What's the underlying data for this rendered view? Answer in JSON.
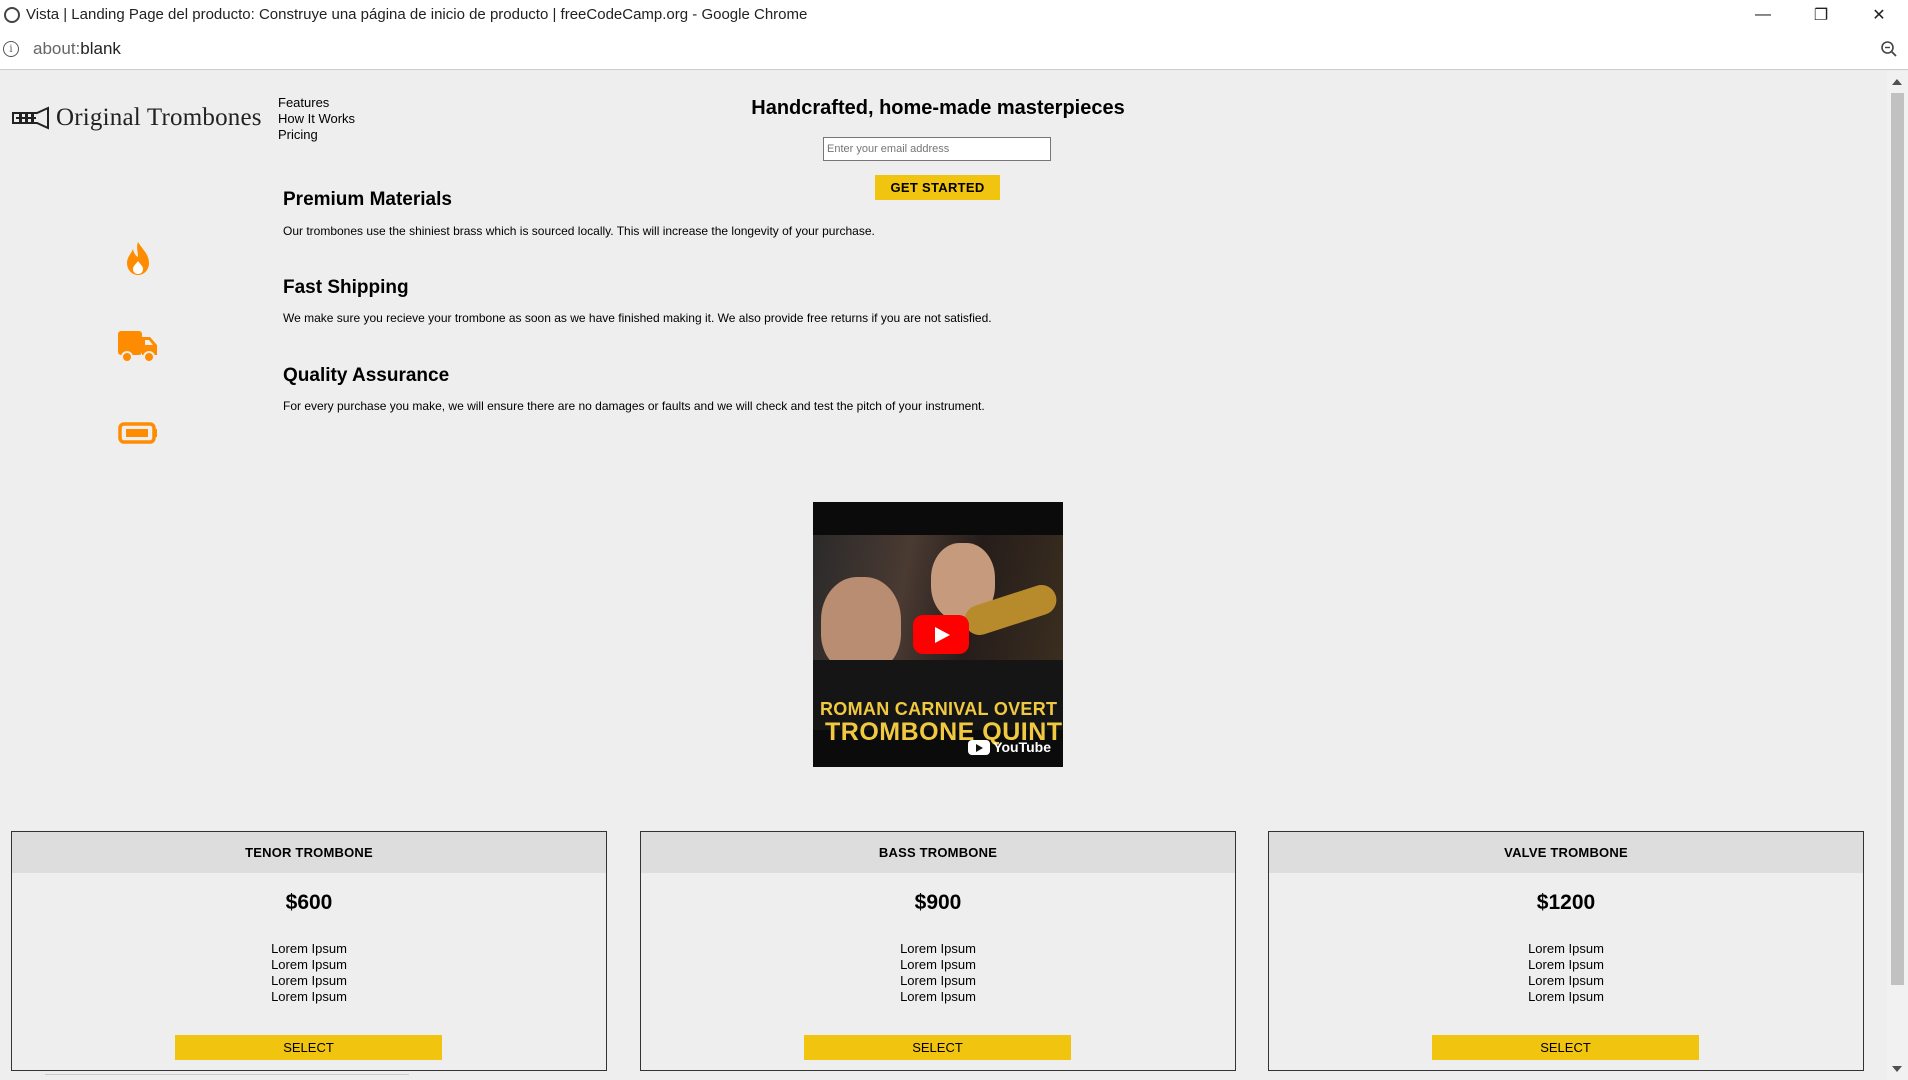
{
  "window": {
    "title": "Vista | Landing Page del producto: Construye una página de inicio de producto | freeCodeCamp.org - Google Chrome",
    "minimize": "—",
    "restore": "❐",
    "close": "✕"
  },
  "address": {
    "scheme": "about:",
    "path": "blank"
  },
  "header": {
    "logo_text": "Original Trombones",
    "nav": [
      "Features",
      "How It Works",
      "Pricing"
    ]
  },
  "hero": {
    "title": "Handcrafted, home-made masterpieces",
    "email_placeholder": "Enter your email address",
    "cta_label": "GET STARTED"
  },
  "features": [
    {
      "icon": "fire-icon",
      "title": "Premium Materials",
      "desc": "Our trombones use the shiniest brass which is sourced locally. This will increase the longevity of your purchase."
    },
    {
      "icon": "truck-icon",
      "title": "Fast Shipping",
      "desc": "We make sure you recieve your trombone as soon as we have finished making it. We also provide free returns if you are not satisfied."
    },
    {
      "icon": "battery-icon",
      "title": "Quality Assurance",
      "desc": "For every purchase you make, we will ensure there are no damages or faults and we will check and test the pitch of your instrument."
    }
  ],
  "video": {
    "caption_line1": "ROMAN CARNIVAL OVERT",
    "caption_line2": "TROMBONE QUINT",
    "brand": "YouTube"
  },
  "products": [
    {
      "level": "TENOR TROMBONE",
      "price": "$600",
      "items": [
        "Lorem Ipsum",
        "Lorem Ipsum",
        "Lorem Ipsum",
        "Lorem Ipsum"
      ],
      "button": "SELECT"
    },
    {
      "level": "BASS TROMBONE",
      "price": "$900",
      "items": [
        "Lorem Ipsum",
        "Lorem Ipsum",
        "Lorem Ipsum",
        "Lorem Ipsum"
      ],
      "button": "SELECT"
    },
    {
      "level": "VALVE TROMBONE",
      "price": "$1200",
      "items": [
        "Lorem Ipsum",
        "Lorem Ipsum",
        "Lorem Ipsum",
        "Lorem Ipsum"
      ],
      "button": "SELECT"
    }
  ],
  "colors": {
    "accent": "#f1c40f",
    "icon_orange": "#ff8c00",
    "page_bg": "#eeeeee"
  }
}
